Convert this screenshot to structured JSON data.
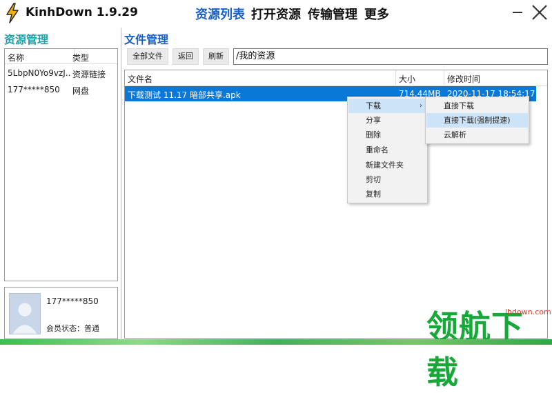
{
  "app": {
    "title": "KinhDown 1.9.29"
  },
  "nav": [
    {
      "label": "资源列表",
      "active": true
    },
    {
      "label": "打开资源",
      "active": false
    },
    {
      "label": "传输管理",
      "active": false
    },
    {
      "label": "更多",
      "active": false
    }
  ],
  "left": {
    "title": "资源管理",
    "columns": [
      "名称",
      "类型"
    ],
    "rows": [
      {
        "name": "5LbpN0Yo9vzJ...",
        "type": "资源链接"
      },
      {
        "name": "177*****850",
        "type": "网盘"
      }
    ]
  },
  "user": {
    "name": "177*****850",
    "status": "会员状态：普通"
  },
  "right": {
    "title": "文件管理",
    "toolbar": {
      "all_files": "全部文件",
      "back": "返回",
      "refresh": "刷新"
    },
    "path": "/我的资源",
    "columns": [
      "文件名",
      "大小",
      "修改时间"
    ],
    "files": [
      {
        "name": "下载测试 11.17 暗部共享.apk",
        "size": "714.44MB",
        "modified": "2020-11-17 18:54:17"
      }
    ]
  },
  "context_menu": {
    "items": [
      "下载",
      "分享",
      "删除",
      "重命名",
      "新建文件夹",
      "剪切",
      "复制"
    ],
    "highlighted": "下载",
    "arrow": "›"
  },
  "submenu": {
    "items": [
      "直接下载",
      "直接下载(强制提速)",
      "云解析"
    ],
    "highlighted": "直接下载(强制提速)"
  },
  "watermark": {
    "text": "领航下载",
    "site": "lhdown.com"
  },
  "colors": {
    "accent": "#1a5fc8",
    "left_title": "#1fa2a8",
    "selection": "#0a78d7",
    "menu_highlight": "#cde4f8",
    "watermark": "#18a83a"
  }
}
